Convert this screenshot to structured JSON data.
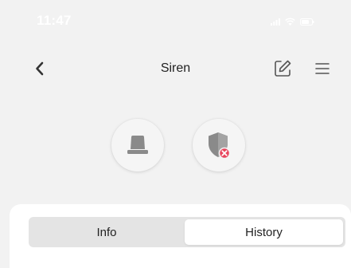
{
  "status_bar": {
    "time": "11:47"
  },
  "header": {
    "title": "Siren",
    "back_icon": "chevron-left-icon",
    "edit_icon": "edit-icon",
    "menu_icon": "hamburger-menu-icon"
  },
  "device_controls": [
    {
      "icon": "siren-icon"
    },
    {
      "icon": "shield-disarmed-icon"
    }
  ],
  "tabs": [
    {
      "label": "Info",
      "active": false
    },
    {
      "label": "History",
      "active": true
    }
  ],
  "colors": {
    "background": "#f2f2f2",
    "alert_red": "#e8475f",
    "icon_gray": "#8a8a8a",
    "tab_bar": "#e4e4e4",
    "active_tab": "#ffffff"
  }
}
